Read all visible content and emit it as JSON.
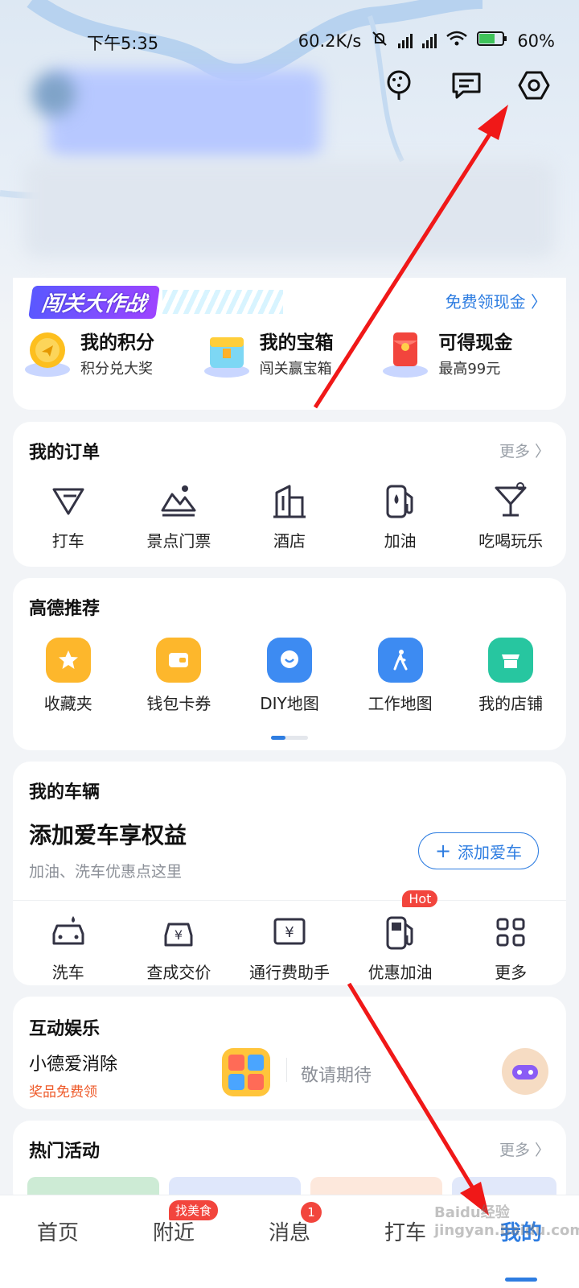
{
  "status_bar": {
    "time": "下午5:35",
    "network_speed": "60.2K/s",
    "battery": "60%"
  },
  "header": {
    "icons": [
      "tree-icon",
      "message-icon",
      "settings-icon"
    ]
  },
  "promo_card": {
    "banner_text": "闯关大作战",
    "free_cash_link": "免费领现金 〉",
    "items": [
      {
        "title": "我的积分",
        "subtitle": "积分兑大奖"
      },
      {
        "title": "我的宝箱",
        "subtitle": "闯关赢宝箱"
      },
      {
        "title": "可得现金",
        "subtitle": "最高99元"
      }
    ]
  },
  "orders": {
    "title": "我的订单",
    "more": "更多 〉",
    "items": [
      {
        "label": "打车",
        "icon": "taxi-icon"
      },
      {
        "label": "景点门票",
        "icon": "scenic-ticket-icon"
      },
      {
        "label": "酒店",
        "icon": "hotel-icon"
      },
      {
        "label": "加油",
        "icon": "fuel-icon"
      },
      {
        "label": "吃喝玩乐",
        "icon": "cocktail-icon"
      }
    ]
  },
  "recommend": {
    "title": "高德推荐",
    "items": [
      {
        "label": "收藏夹",
        "icon": "star-icon",
        "color": "#fdb72c"
      },
      {
        "label": "钱包卡券",
        "icon": "wallet-icon",
        "color": "#fdb72c"
      },
      {
        "label": "DIY地图",
        "icon": "diy-map-icon",
        "color": "#3d8bf2"
      },
      {
        "label": "工作地图",
        "icon": "walker-icon",
        "color": "#3d8bf2"
      },
      {
        "label": "我的店铺",
        "icon": "store-icon",
        "color": "#27c6a0"
      }
    ]
  },
  "vehicle": {
    "title": "我的车辆",
    "headline": "添加爱车享权益",
    "subtext": "加油、洗车优惠点这里",
    "add_button": "添加爱车",
    "hot_badge": "Hot",
    "items": [
      {
        "label": "洗车",
        "icon": "car-wash-icon"
      },
      {
        "label": "查成交价",
        "icon": "price-check-icon"
      },
      {
        "label": "通行费助手",
        "icon": "toll-icon"
      },
      {
        "label": "优惠加油",
        "icon": "fuel-icon"
      },
      {
        "label": "更多",
        "icon": "grid-icon"
      }
    ]
  },
  "entertainment": {
    "title": "互动娱乐",
    "game_title": "小德爱消除",
    "game_sub": "奖品免费领",
    "coming_soon": "敬请期待"
  },
  "activities": {
    "title": "热门活动",
    "more": "更多 〉"
  },
  "bottom_nav": {
    "items": [
      {
        "label": "首页"
      },
      {
        "label": "附近",
        "badge": "找美食"
      },
      {
        "label": "消息",
        "badge": "1"
      },
      {
        "label": "打车"
      },
      {
        "label": "我的",
        "active": true
      }
    ]
  },
  "watermark": "Baidu经验 jingyan.baidu.com",
  "colors": {
    "accent": "#2e7de1",
    "badge_red": "#f2453d"
  }
}
